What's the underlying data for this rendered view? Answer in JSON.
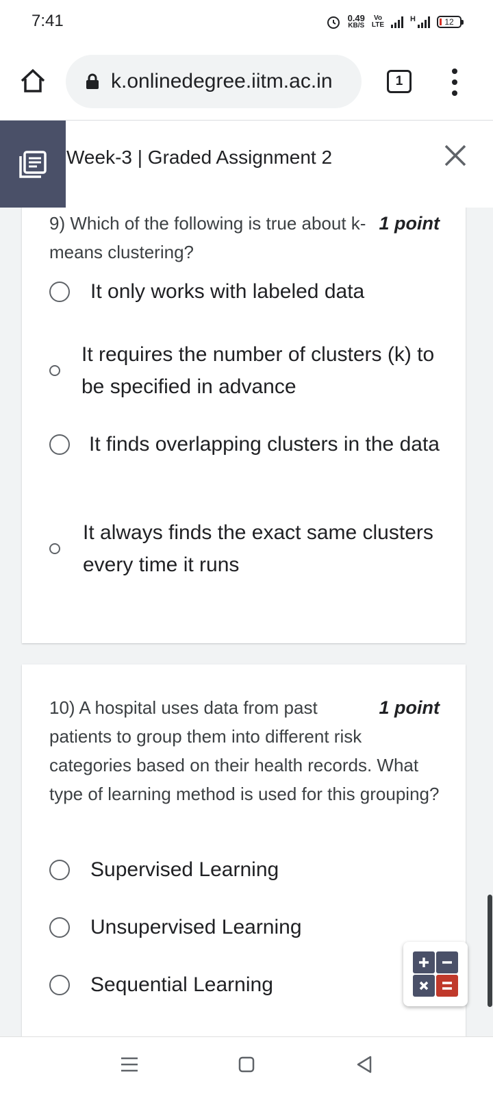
{
  "status_bar": {
    "time": "7:41",
    "net_speed_value": "0.49",
    "net_speed_unit": "KB/S",
    "volte_top": "Vo",
    "volte_bottom": "LTE",
    "signal_2_label": "H",
    "battery_level": "12"
  },
  "browser": {
    "url": "k.onlinedegree.iitm.ac.in",
    "tab_count": "1"
  },
  "page": {
    "title": "Week-3 | Graded Assignment 2"
  },
  "questions": [
    {
      "number": "9)",
      "text": "Which of the following is true about k-means clustering?",
      "points": "1 point",
      "options": [
        "It only works with labeled data",
        "It requires the number of clusters (k) to be specified in advance",
        "It finds overlapping clusters in the data",
        "It always finds the exact same clusters every time it runs"
      ]
    },
    {
      "number": "10)",
      "text": "A hospital uses data from past patients to group them into different risk categories based on their health records. What type of learning method is used for this grouping?",
      "points": "1 point",
      "options": [
        "Supervised Learning",
        "Unsupervised Learning",
        "Sequential Learning"
      ]
    }
  ],
  "icons": {
    "home": "home-icon",
    "lock": "lock-icon",
    "menu": "more-vert-icon",
    "nav_toggle": "list-icon",
    "close": "close-icon",
    "calculator": "calculator-icon"
  },
  "colors": {
    "nav_toggle_bg": "#4a5068",
    "calc_blue": "#4a5068",
    "calc_red": "#c0392b"
  }
}
